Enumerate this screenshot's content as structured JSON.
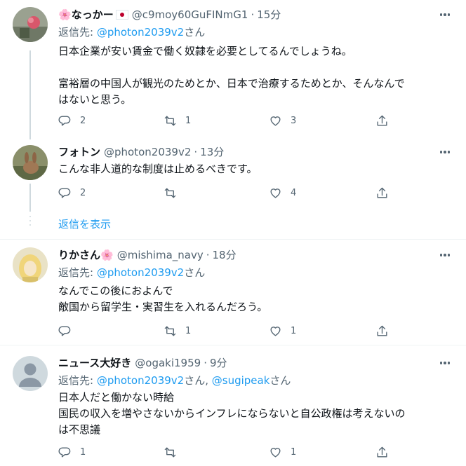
{
  "tweets": [
    {
      "name_prefix": "🌸",
      "name": "なっかー",
      "handle": "@c9moy60GuFINmG1",
      "time": "15分",
      "reply_label": "返信先:",
      "reply_to": "@photon2039v2",
      "reply_suffix": "さん",
      "text": "日本企業が安い賃金で働く奴隷を必要としてるんでしょうね。\n\n富裕層の中国人が観光のためとか、日本で治療するためとか、そんなんで\nはないと思う。",
      "replies": "2",
      "retweets": "1",
      "likes": "3"
    },
    {
      "name": "フォトン",
      "handle": "@photon2039v2",
      "time": "13分",
      "text": "こんな非人道的な制度は止めるべきです。",
      "replies": "2",
      "retweets": "",
      "likes": "4"
    },
    {
      "name": "りかさん",
      "name_suffix": "🌸",
      "handle": "@mishima_navy",
      "time": "18分",
      "reply_label": "返信先:",
      "reply_to": "@photon2039v2",
      "reply_suffix": "さん",
      "text": "なんでこの後におよんで\n敵国から留学生・実習生を入れるんだろう。",
      "replies": "",
      "retweets": "1",
      "likes": "1"
    },
    {
      "name": "ニュース大好き",
      "handle": "@ogaki1959",
      "time": "9分",
      "reply_label": "返信先:",
      "reply_to": "@photon2039v2",
      "reply_sep": "さん, ",
      "reply_to_2": "@sugipeak",
      "reply_suffix": "さん",
      "text": "日本人だと働かない時給\n国民の収入を増やさないからインフレにならないと自公政権は考えないの\nは不思議",
      "replies": "1",
      "retweets": "",
      "likes": "1"
    }
  ],
  "show_replies": "返信を表示",
  "colors": {
    "link": "#1d9bf0",
    "secondary_text": "#536471",
    "primary_text": "#0f1419",
    "divider": "#eff3f4"
  },
  "icons": [
    "reply-icon",
    "retweet-icon",
    "like-icon",
    "share-icon",
    "more-icon"
  ]
}
